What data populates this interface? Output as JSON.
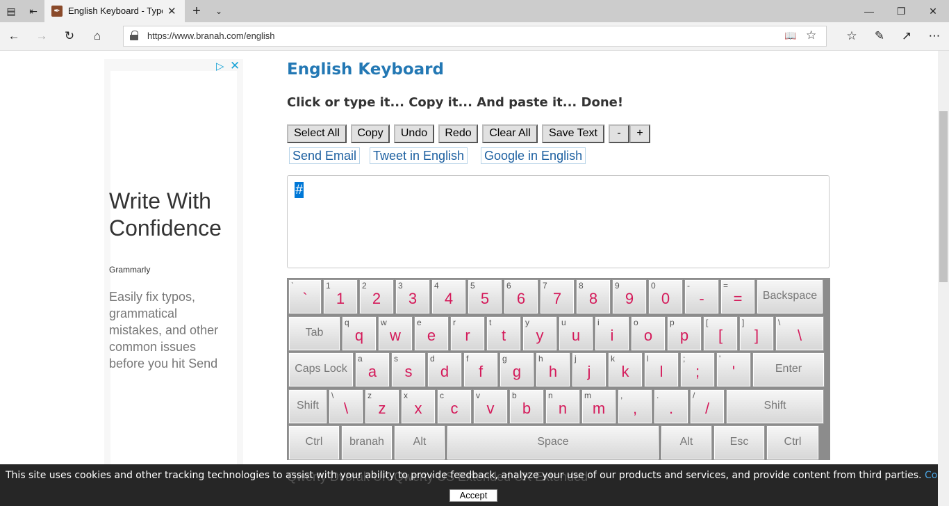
{
  "browser": {
    "tab_title": "English Keyboard - Type",
    "address": "https://www.branah.com/english"
  },
  "ad": {
    "headline": "Write With Confidence",
    "brand": "Grammarly",
    "body": "Easily fix typos, grammatical mistakes, and other common issues before you hit Send"
  },
  "page": {
    "title": "English Keyboard",
    "tagline": "Click or type it... Copy it... And paste it... Done!",
    "toolbar": [
      "Select All",
      "Copy",
      "Undo",
      "Redo",
      "Clear All",
      "Save Text",
      "-",
      "+"
    ],
    "links": [
      "Send Email",
      "Tweet in English",
      "Google in English"
    ],
    "text_value": "#"
  },
  "keyboard": {
    "row1": [
      {
        "sm": "`",
        "big": "`"
      },
      {
        "sm": "1",
        "big": "1"
      },
      {
        "sm": "2",
        "big": "2"
      },
      {
        "sm": "3",
        "big": "3"
      },
      {
        "sm": "4",
        "big": "4"
      },
      {
        "sm": "5",
        "big": "5"
      },
      {
        "sm": "6",
        "big": "6"
      },
      {
        "sm": "7",
        "big": "7"
      },
      {
        "sm": "8",
        "big": "8"
      },
      {
        "sm": "9",
        "big": "9"
      },
      {
        "sm": "0",
        "big": "0"
      },
      {
        "sm": "-",
        "big": "-"
      },
      {
        "sm": "=",
        "big": "="
      },
      {
        "fn": "Backspace"
      }
    ],
    "row2": [
      {
        "fn": "Tab"
      },
      {
        "sm": "q",
        "big": "q"
      },
      {
        "sm": "w",
        "big": "w"
      },
      {
        "sm": "e",
        "big": "e"
      },
      {
        "sm": "r",
        "big": "r"
      },
      {
        "sm": "t",
        "big": "t"
      },
      {
        "sm": "y",
        "big": "y"
      },
      {
        "sm": "u",
        "big": "u"
      },
      {
        "sm": "i",
        "big": "i"
      },
      {
        "sm": "o",
        "big": "o"
      },
      {
        "sm": "p",
        "big": "p"
      },
      {
        "sm": "[",
        "big": "["
      },
      {
        "sm": "]",
        "big": "]"
      },
      {
        "sm": "\\",
        "big": "\\"
      }
    ],
    "row3": [
      {
        "fn": "Caps Lock"
      },
      {
        "sm": "a",
        "big": "a"
      },
      {
        "sm": "s",
        "big": "s"
      },
      {
        "sm": "d",
        "big": "d"
      },
      {
        "sm": "f",
        "big": "f"
      },
      {
        "sm": "g",
        "big": "g"
      },
      {
        "sm": "h",
        "big": "h"
      },
      {
        "sm": "j",
        "big": "j"
      },
      {
        "sm": "k",
        "big": "k"
      },
      {
        "sm": "l",
        "big": "l"
      },
      {
        "sm": ";",
        "big": ";"
      },
      {
        "sm": "'",
        "big": "'"
      },
      {
        "fn": "Enter"
      }
    ],
    "row4": [
      {
        "fn": "Shift"
      },
      {
        "sm": "\\",
        "big": "\\"
      },
      {
        "sm": "z",
        "big": "z"
      },
      {
        "sm": "x",
        "big": "x"
      },
      {
        "sm": "c",
        "big": "c"
      },
      {
        "sm": "v",
        "big": "v"
      },
      {
        "sm": "b",
        "big": "b"
      },
      {
        "sm": "n",
        "big": "n"
      },
      {
        "sm": "m",
        "big": "m"
      },
      {
        "sm": ",",
        "big": ","
      },
      {
        "sm": ".",
        "big": "."
      },
      {
        "sm": "/",
        "big": "/"
      },
      {
        "fn": "Shift"
      }
    ],
    "row5": [
      {
        "fn": "Ctrl"
      },
      {
        "fn": "branah"
      },
      {
        "fn": "Alt"
      },
      {
        "fn": "Space"
      },
      {
        "fn": "Alt"
      },
      {
        "fn": "Esc"
      },
      {
        "fn": "Ctrl"
      }
    ]
  },
  "layout_options_partial": "Qwerty     Dvorak     UK Qwerty     US Extended     UK Extended",
  "cookie": {
    "message": "This site uses cookies and other tracking technologies to assist with your ability to provide feedback, analyze your use of our products and services, and provide content from third parties.",
    "policy_link": "Cookie Policy",
    "accept_label": "Accept"
  }
}
